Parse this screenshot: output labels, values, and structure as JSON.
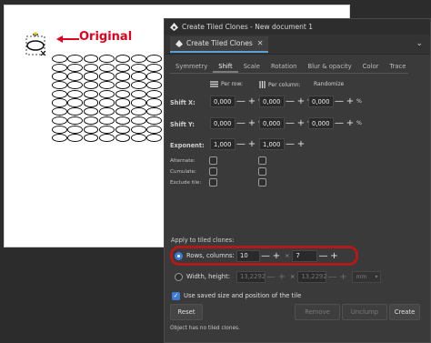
{
  "canvas": {
    "annotation_label": "Original",
    "annotation_color": "#e4001c",
    "grid": {
      "rows": 10,
      "columns": 7
    }
  },
  "dialog": {
    "window_title": "Create Tiled Clones - New document 1",
    "tab_label": "Create Tiled Clones",
    "tab_close_icon": "close-icon",
    "menu_icon": "chevron-down-icon",
    "subtabs": [
      "Symmetry",
      "Shift",
      "Scale",
      "Rotation",
      "Blur & opacity",
      "Color",
      "Trace"
    ],
    "active_subtab": "Shift",
    "headers": {
      "per_row": "Per row:",
      "per_column": "Per column:",
      "randomize": "Randomize"
    },
    "shift_x": {
      "label": "Shift X:",
      "per_row": "0,000",
      "per_column": "0,000",
      "randomize": "0,000",
      "unit": "%"
    },
    "shift_y": {
      "label": "Shift Y:",
      "per_row": "0,000",
      "per_column": "0,000",
      "randomize": "0,000",
      "unit": "%"
    },
    "exponent": {
      "label": "Exponent:",
      "per_row": "1,000",
      "per_column": "1,000"
    },
    "alternate_label": "Alternate:",
    "cumulate_label": "Cumulate:",
    "exclude_tile_label": "Exclude tile:",
    "apply_label": "Apply to tiled clones:",
    "rows_columns": {
      "label": "Rows, columns:",
      "rows": "10",
      "columns": "7",
      "times": "×",
      "selected": true
    },
    "width_height": {
      "label": "Width, height:",
      "width": "13,2292",
      "height": "13,2292",
      "unit": "mm",
      "times": "×"
    },
    "use_saved": {
      "label": "Use saved size and position of the tile",
      "checked": true
    },
    "buttons": {
      "reset": "Reset",
      "remove": "Remove",
      "unclump": "Unclump",
      "create": "Create"
    },
    "status": "Object has no tiled clones.",
    "plus": "+",
    "minus": "—",
    "highlight_color": "#b11a1a",
    "accent_color": "#3d7bd6"
  }
}
